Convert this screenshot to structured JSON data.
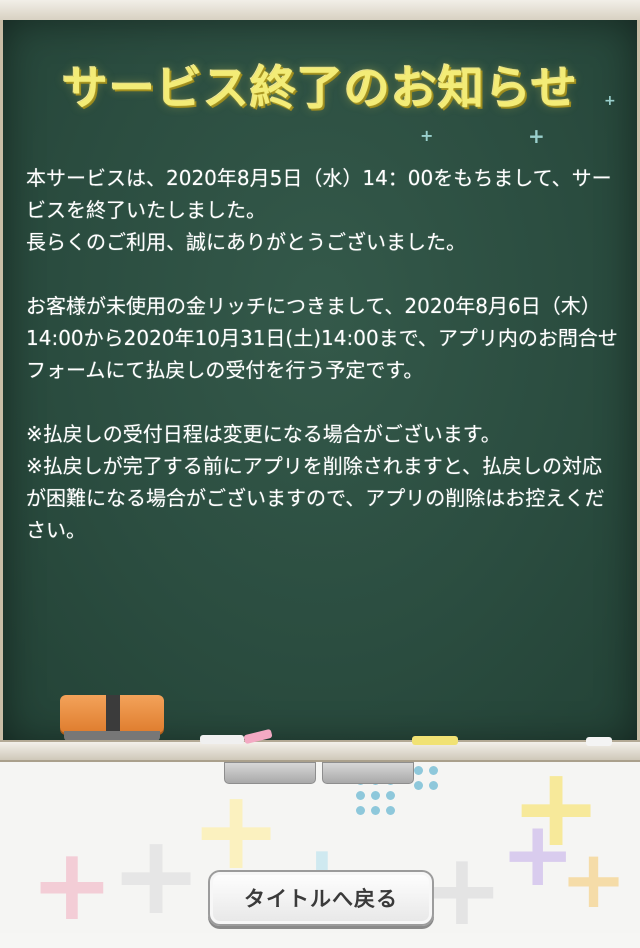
{
  "notice": {
    "title": "サービス終了のお知らせ",
    "paragraphs": [
      "本サービスは、2020年8月5日（水）14：00をもちまして、サービスを終了いたしました。",
      "長らくのご利用、誠にありがとうございました。",
      "",
      "お客様が未使用の金リッチにつきまして、2020年8月6日（木）14:00から2020年10月31日(土)14:00まで、アプリ内のお問合せフォームにて払戻しの受付を行う予定です。",
      "",
      "※払戻しの受付日程は変更になる場合がございます。",
      "※払戻しが完了する前にアプリを削除されますと、払戻しの対応が困難になる場合がございますので、アプリの削除はお控えください。"
    ]
  },
  "footer": {
    "back_label": "タイトルへ戻る"
  },
  "colors": {
    "board": "#2b4d40",
    "title": "#f3ec77",
    "text": "#ffffff",
    "eraser": "#e8893a"
  }
}
